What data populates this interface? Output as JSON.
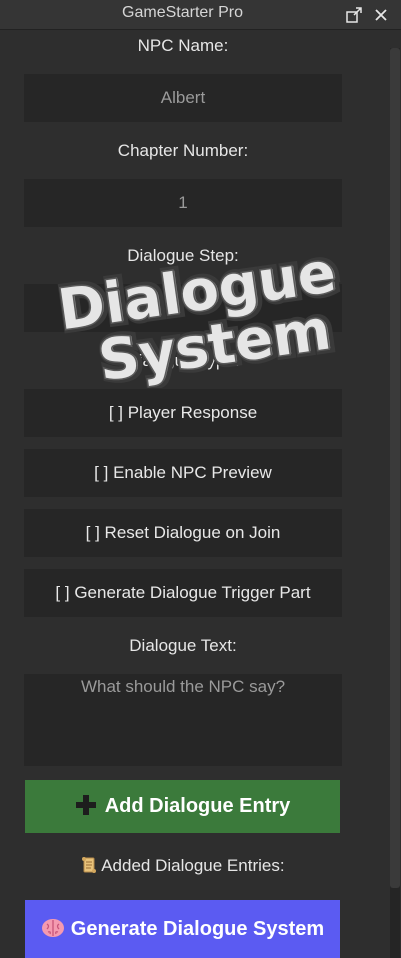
{
  "window": {
    "title": "GameStarter Pro",
    "dock_icon": "dock-icon",
    "close_icon": "close-icon"
  },
  "form": {
    "npc_name_label": "NPC Name:",
    "npc_name_value": "Albert",
    "chapter_label": "Chapter Number:",
    "chapter_value": "1",
    "step_label": "Dialogue Step:",
    "type_label": "Dialogue Type:",
    "toggles": [
      "[ ] Player Response",
      "[ ] Enable NPC Preview",
      "[ ] Reset Dialogue on Join",
      "[ ] Generate Dialogue Trigger Part"
    ],
    "text_label": "Dialogue Text:",
    "text_placeholder": "What should the NPC say?",
    "add_button_label": "Add Dialogue Entry",
    "add_button_icon": "plus-icon",
    "entries_label": "Added Dialogue Entries:",
    "entries_icon": "scroll-icon",
    "generate_button_label": "Generate Dialogue System",
    "generate_button_icon": "brain-icon"
  },
  "overlay": {
    "line1": "Dialogue",
    "line2": "System"
  },
  "colors": {
    "add_button": "#3b7a3b",
    "generate_button": "#5b5bf2",
    "field_bg": "#262626",
    "panel_bg": "#2e2e2e"
  }
}
